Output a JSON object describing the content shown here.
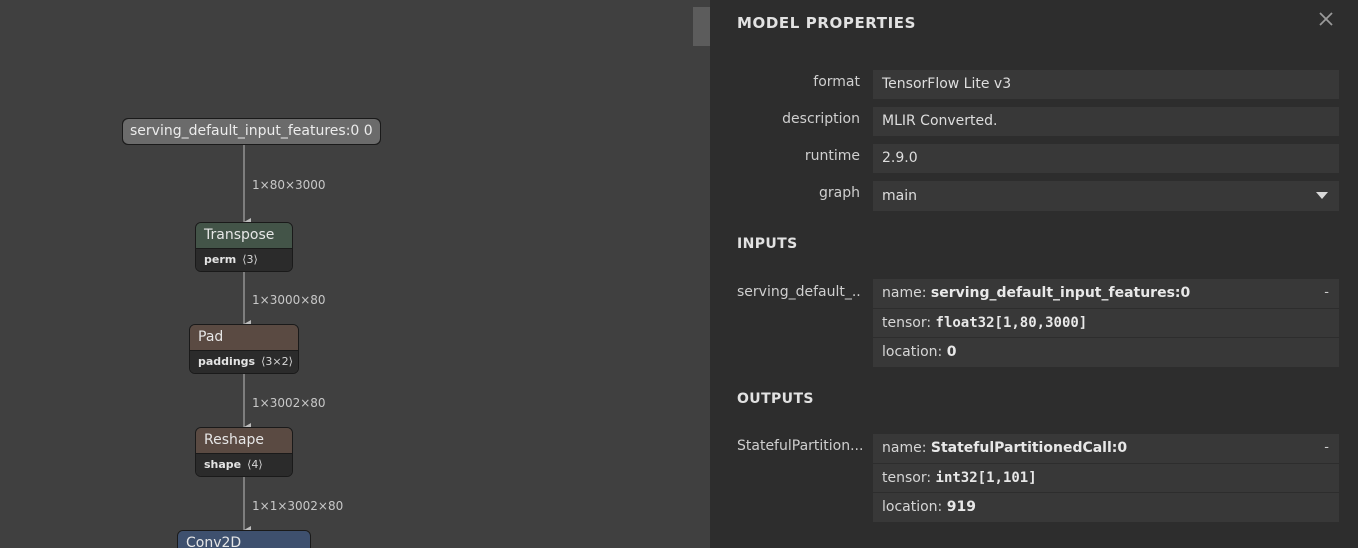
{
  "graph": {
    "input_node": {
      "label": "serving_default_input_features:0 0",
      "color": "#6b6b6b"
    },
    "nodes": [
      {
        "id": "transpose",
        "name": "Transpose",
        "attr_name": "perm",
        "attr_value": "⟨3⟩",
        "color": "#435448"
      },
      {
        "id": "pad",
        "name": "Pad",
        "attr_name": "paddings",
        "attr_value": "⟨3×2⟩",
        "color": "#5a4a42"
      },
      {
        "id": "reshape",
        "name": "Reshape",
        "attr_name": "shape",
        "attr_value": "⟨4⟩",
        "color": "#5a4a42"
      },
      {
        "id": "conv2d",
        "name": "Conv2D",
        "color": "#3e506e"
      }
    ],
    "edges": [
      {
        "label": "1×80×3000"
      },
      {
        "label": "1×3000×80"
      },
      {
        "label": "1×3002×80"
      },
      {
        "label": "1×1×3002×80"
      }
    ]
  },
  "panel": {
    "title": "MODEL PROPERTIES",
    "close_icon": "close-x",
    "properties": [
      {
        "label": "format",
        "value": "TensorFlow Lite v3"
      },
      {
        "label": "description",
        "value": "MLIR Converted."
      },
      {
        "label": "runtime",
        "value": "2.9.0"
      }
    ],
    "graph_select": {
      "label": "graph",
      "value": "main"
    },
    "inputs": {
      "title": "INPUTS",
      "label": "serving_default_...",
      "name_key": "name: ",
      "name": "serving_default_input_features:0",
      "tensor_key": "tensor: ",
      "tensor": "float32[1,80,3000]",
      "location_key": "location: ",
      "location": "0",
      "expander": "-"
    },
    "outputs": {
      "title": "OUTPUTS",
      "label": "StatefulPartition...",
      "name_key": "name: ",
      "name": "StatefulPartitionedCall:0",
      "tensor_key": "tensor: ",
      "tensor": "int32[1,101]",
      "location_key": "location: ",
      "location": "919",
      "expander": "-"
    }
  }
}
